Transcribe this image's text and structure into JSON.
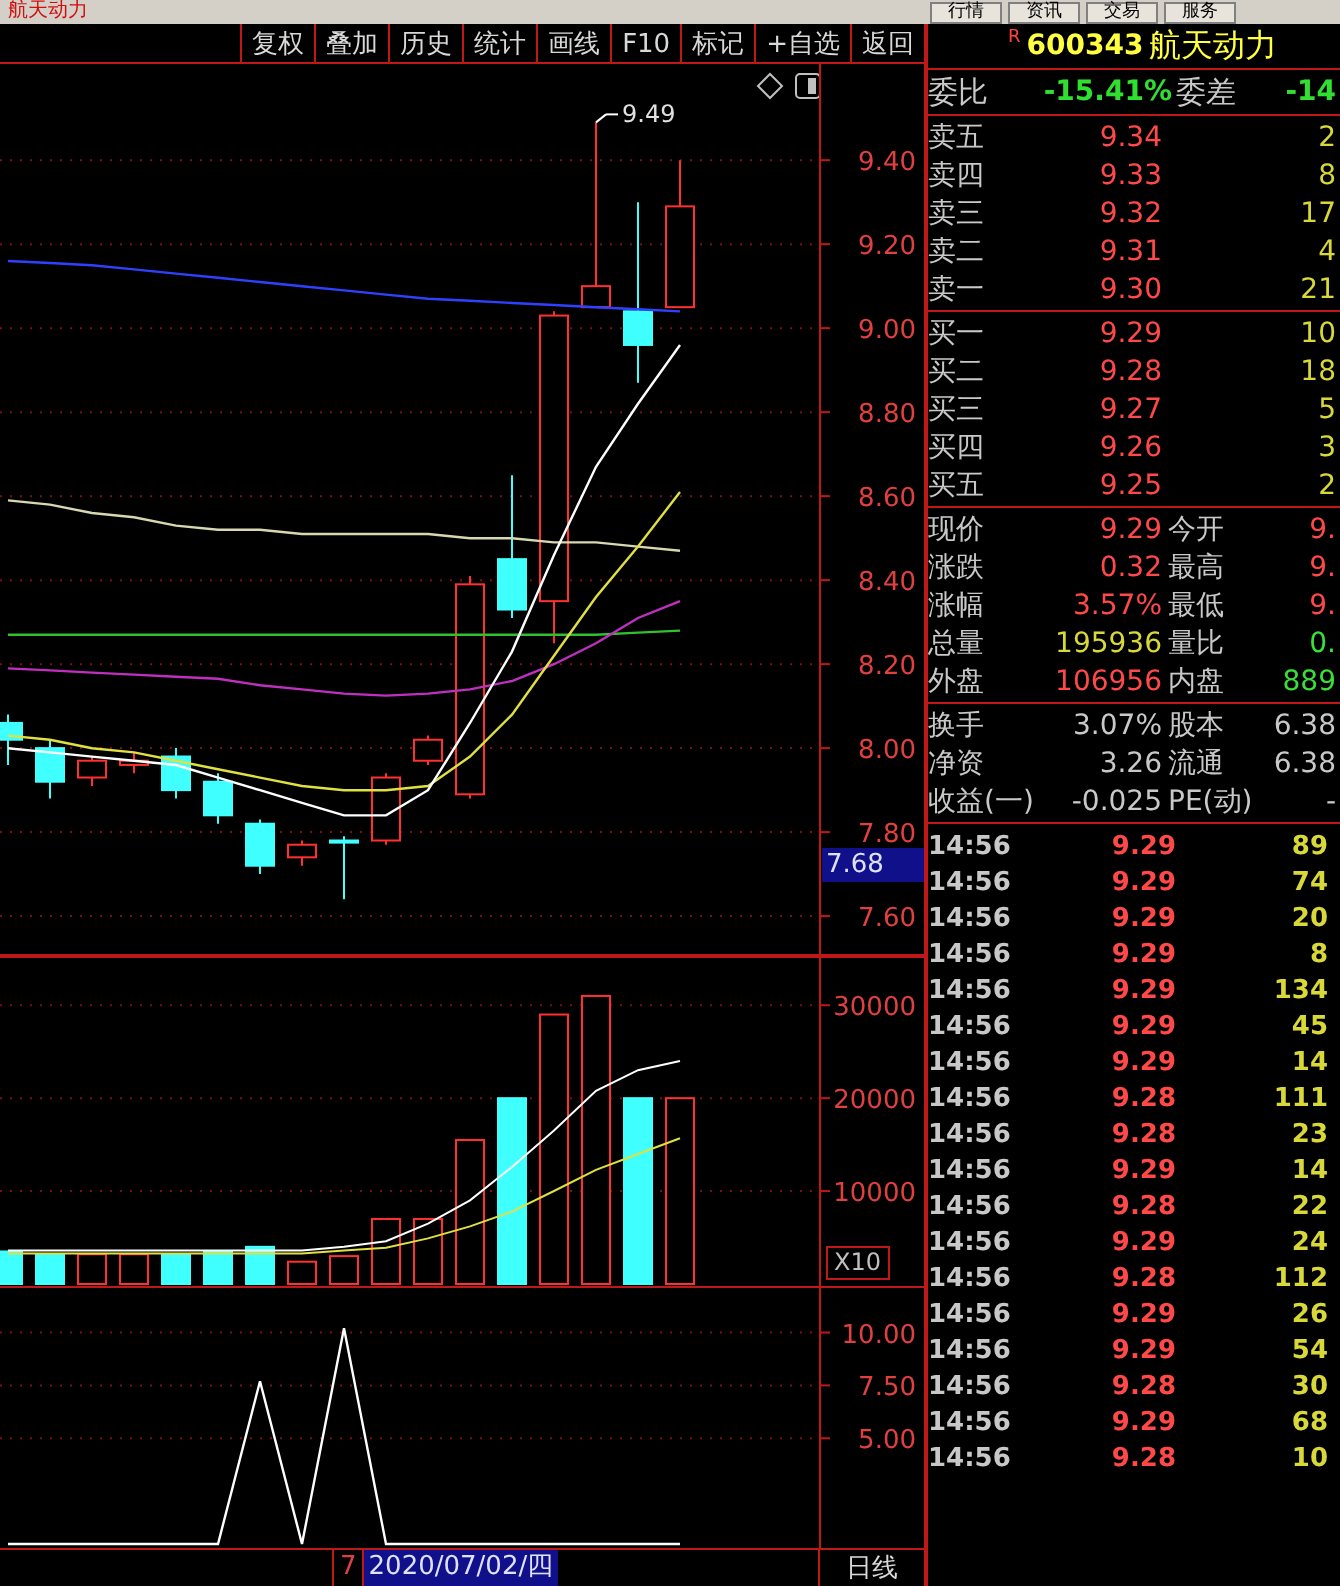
{
  "title_bar": {
    "title": "航天动力",
    "buttons": [
      "行情",
      "资讯",
      "交易",
      "服务"
    ]
  },
  "toolbar": {
    "buttons": [
      "复权",
      "叠加",
      "历史",
      "统计",
      "画线",
      "F10",
      "标记",
      "+自选",
      "返回"
    ]
  },
  "price_chart": {
    "high_label": "9.49",
    "current_label": "7.68",
    "chart_data": {
      "type": "line",
      "ylim": [
        7.505,
        9.629
      ],
      "grid": true,
      "yticks": [
        {
          "value": 9.4,
          "label": "9.40"
        },
        {
          "value": 9.2,
          "label": "9.20"
        },
        {
          "value": 9.0,
          "label": "9.00"
        },
        {
          "value": 8.8,
          "label": "8.80"
        },
        {
          "value": 8.6,
          "label": "8.60"
        },
        {
          "value": 8.4,
          "label": "8.40"
        },
        {
          "value": 8.2,
          "label": "8.20"
        },
        {
          "value": 8.0,
          "label": "8.00"
        },
        {
          "value": 7.8,
          "label": "7.80"
        },
        {
          "value": 7.6,
          "label": "7.60"
        }
      ],
      "series": [
        {
          "color": "#3040ff",
          "values": [
            9.16,
            9.155,
            9.15,
            9.14,
            9.13,
            9.12,
            9.11,
            9.1,
            9.09,
            9.08,
            9.07,
            9.065,
            9.06,
            9.055,
            9.05,
            9.045,
            9.04
          ]
        },
        {
          "color": "#d8d8b0",
          "values": [
            8.59,
            8.58,
            8.56,
            8.55,
            8.53,
            8.52,
            8.52,
            8.51,
            8.51,
            8.51,
            8.51,
            8.5,
            8.5,
            8.49,
            8.49,
            8.48,
            8.47
          ]
        },
        {
          "color": "#30c030",
          "values": [
            8.27,
            8.27,
            8.27,
            8.27,
            8.27,
            8.27,
            8.27,
            8.27,
            8.27,
            8.27,
            8.27,
            8.27,
            8.27,
            8.27,
            8.27,
            8.275,
            8.28
          ]
        },
        {
          "color": "#c030c0",
          "values": [
            8.19,
            8.185,
            8.18,
            8.175,
            8.17,
            8.165,
            8.15,
            8.14,
            8.13,
            8.125,
            8.13,
            8.14,
            8.16,
            8.2,
            8.25,
            8.31,
            8.35
          ]
        },
        {
          "color": "#e0e040",
          "values": [
            8.03,
            8.02,
            8.0,
            7.99,
            7.97,
            7.95,
            7.93,
            7.91,
            7.9,
            7.9,
            7.91,
            7.98,
            8.08,
            8.22,
            8.36,
            8.48,
            8.61
          ]
        },
        {
          "color": "#ffffff",
          "values": [
            8.0,
            7.99,
            7.98,
            7.97,
            7.96,
            7.93,
            7.9,
            7.87,
            7.84,
            7.84,
            7.9,
            8.06,
            8.23,
            8.46,
            8.67,
            8.82,
            8.96
          ]
        }
      ]
    }
  },
  "volume_chart": {
    "unit_label": "X10",
    "chart_data": {
      "type": "bar",
      "ylim": [
        0,
        35300
      ],
      "grid": true,
      "yticks": [
        {
          "value": 30000,
          "label": "30000"
        },
        {
          "value": 20000,
          "label": "20000"
        },
        {
          "value": 10000,
          "label": "10000"
        }
      ],
      "series": [
        {
          "color": "#ff3030",
          "values": [
            null,
            null,
            3200,
            3200,
            null,
            null,
            null,
            2400,
            3000,
            7000,
            7000,
            15500,
            null,
            29000,
            31000,
            null,
            20000
          ]
        },
        {
          "color": "#40ffff",
          "values": [
            3500,
            3200,
            null,
            null,
            3200,
            3500,
            4000,
            null,
            null,
            null,
            null,
            null,
            20000,
            null,
            null,
            20000,
            null
          ]
        },
        {
          "type": "line",
          "color": "#ffffff",
          "values": [
            3600,
            3600,
            3600,
            3600,
            3600,
            3600,
            3600,
            3600,
            4000,
            4600,
            6500,
            9000,
            12600,
            16500,
            20800,
            23000,
            24000
          ]
        },
        {
          "type": "line",
          "color": "#e0e040",
          "values": [
            3300,
            3300,
            3300,
            3300,
            3300,
            3300,
            3300,
            3300,
            3600,
            3900,
            4900,
            6200,
            7800,
            10000,
            12300,
            14000,
            15700
          ]
        }
      ]
    }
  },
  "indicator_chart": {
    "chart_data": {
      "type": "line",
      "ylim": [
        0,
        12.2
      ],
      "grid": true,
      "yticks": [
        {
          "value": 10,
          "label": "10.00"
        },
        {
          "value": 7.5,
          "label": "7.50"
        },
        {
          "value": 5,
          "label": "5.00"
        }
      ],
      "series": [
        {
          "color": "#ffffff",
          "values": [
            0,
            0,
            0,
            0,
            0,
            0,
            7.7,
            0,
            10.2,
            0,
            0,
            0,
            0,
            0,
            0,
            0,
            0
          ]
        }
      ]
    }
  },
  "bottom_bar": {
    "count": "7",
    "date": "2020/07/02/四",
    "period": "日线"
  },
  "quote": {
    "flag": "R",
    "code": "600343",
    "name": "航天动力",
    "ratio": {
      "label": "委比",
      "value": "-15.41%",
      "label2": "委差",
      "value2": "-14"
    },
    "asks": [
      {
        "label": "卖五",
        "price": "9.34",
        "volume": "2"
      },
      {
        "label": "卖四",
        "price": "9.33",
        "volume": "8"
      },
      {
        "label": "卖三",
        "price": "9.32",
        "volume": "17"
      },
      {
        "label": "卖二",
        "price": "9.31",
        "volume": "4"
      },
      {
        "label": "卖一",
        "price": "9.30",
        "volume": "21"
      }
    ],
    "bids": [
      {
        "label": "买一",
        "price": "9.29",
        "volume": "10"
      },
      {
        "label": "买二",
        "price": "9.28",
        "volume": "18"
      },
      {
        "label": "买三",
        "price": "9.27",
        "volume": "5"
      },
      {
        "label": "买四",
        "price": "9.26",
        "volume": "3"
      },
      {
        "label": "买五",
        "price": "9.25",
        "volume": "2"
      }
    ],
    "stats": [
      {
        "label": "现价",
        "value": "9.29",
        "color": "#ff4848"
      },
      {
        "label": "今开",
        "value": "9.",
        "color": "#ff4848"
      },
      {
        "label": "涨跌",
        "value": "0.32",
        "color": "#ff4848"
      },
      {
        "label": "最高",
        "value": "9.",
        "color": "#ff4848"
      },
      {
        "label": "涨幅",
        "value": "3.57%",
        "color": "#ff4848"
      },
      {
        "label": "最低",
        "value": "9.",
        "color": "#ff4848"
      },
      {
        "label": "总量",
        "value": "195936",
        "color": "#d8d838"
      },
      {
        "label": "量比",
        "value": "0.",
        "color": "#38e038"
      },
      {
        "label": "外盘",
        "value": "106956",
        "color": "#ff4848"
      },
      {
        "label": "内盘",
        "value": "889",
        "color": "#38e038"
      }
    ],
    "info": [
      {
        "label": "换手",
        "value": "3.07%",
        "label2": "股本",
        "value2": "6.38"
      },
      {
        "label": "净资",
        "value": "3.26",
        "label2": "流通",
        "value2": "6.38"
      },
      {
        "label": "收益(一)",
        "value": "-0.025",
        "label2": "PE(动)",
        "value2": "-"
      }
    ],
    "ticks": [
      {
        "time": "14:56",
        "price": "9.29",
        "volume": "89"
      },
      {
        "time": "14:56",
        "price": "9.29",
        "volume": "74"
      },
      {
        "time": "14:56",
        "price": "9.29",
        "volume": "20"
      },
      {
        "time": "14:56",
        "price": "9.29",
        "volume": "8"
      },
      {
        "time": "14:56",
        "price": "9.29",
        "volume": "134"
      },
      {
        "time": "14:56",
        "price": "9.29",
        "volume": "45"
      },
      {
        "time": "14:56",
        "price": "9.29",
        "volume": "14"
      },
      {
        "time": "14:56",
        "price": "9.28",
        "volume": "111"
      },
      {
        "time": "14:56",
        "price": "9.28",
        "volume": "23"
      },
      {
        "time": "14:56",
        "price": "9.29",
        "volume": "14"
      },
      {
        "time": "14:56",
        "price": "9.28",
        "volume": "22"
      },
      {
        "time": "14:56",
        "price": "9.29",
        "volume": "24"
      },
      {
        "time": "14:56",
        "price": "9.28",
        "volume": "112"
      },
      {
        "time": "14:56",
        "price": "9.29",
        "volume": "26"
      },
      {
        "time": "14:56",
        "price": "9.29",
        "volume": "54"
      },
      {
        "time": "14:56",
        "price": "9.28",
        "volume": "30"
      },
      {
        "time": "14:56",
        "price": "9.29",
        "volume": "68"
      },
      {
        "time": "14:56",
        "price": "9.28",
        "volume": "10"
      }
    ]
  }
}
